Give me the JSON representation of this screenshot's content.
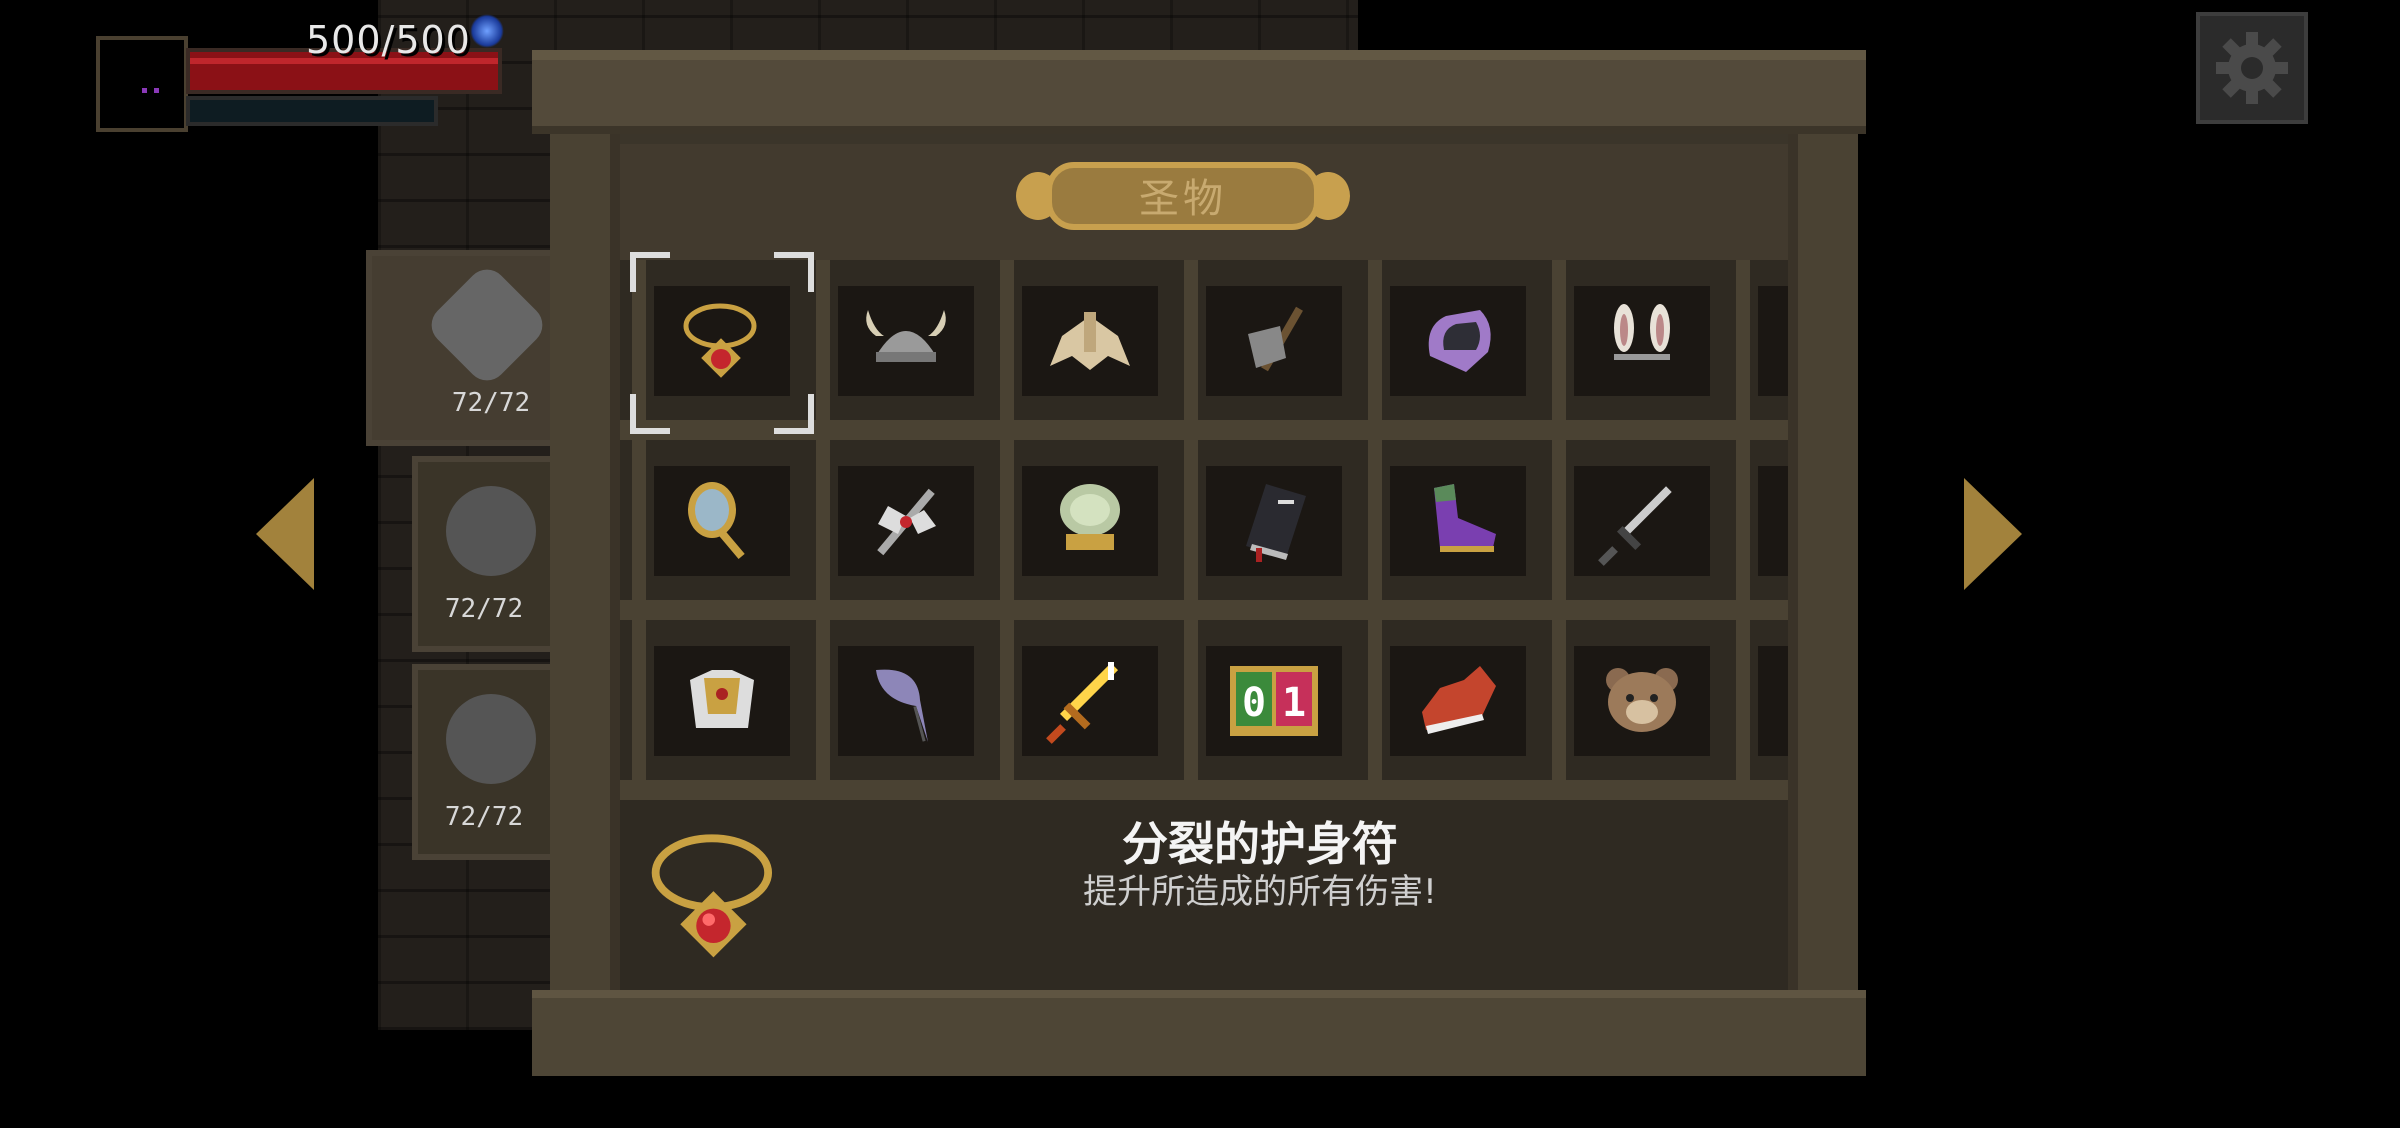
{
  "hud": {
    "hp_text": "500/500",
    "hp_fraction": 1.0
  },
  "panel": {
    "title": "圣物"
  },
  "side_tabs": [
    {
      "icon": "sword-icon",
      "count": "72/72"
    },
    {
      "icon": "shield-icon",
      "count": "72/72"
    },
    {
      "icon": "skull-icon",
      "count": "72/72"
    }
  ],
  "relics": {
    "rows": [
      [
        "necklace-icon",
        "viking-helmet-icon",
        "golden-wing-icon",
        "stone-axe-icon",
        "purple-gauntlet-icon",
        "bunny-ears-icon"
      ],
      [
        "hand-mirror-icon",
        "double-axe-icon",
        "bubble-ring-icon",
        "black-book-icon",
        "purple-boot-icon",
        "dagger-icon"
      ],
      [
        "golden-armor-icon",
        "feather-quill-icon",
        "golden-sword-icon",
        "counter-icon",
        "red-sneaker-icon",
        "bear-head-icon"
      ]
    ],
    "counter_digits": [
      "0",
      "1"
    ],
    "selected_row": 0,
    "selected_col": 0
  },
  "selected": {
    "name": "分裂的护身符",
    "description": "提升所造成的所有伤害!"
  },
  "colors": {
    "gold": "#a2823c",
    "hp_red": "#8b1116",
    "wood": "#4a4233",
    "shelf": "#2f2a22"
  }
}
